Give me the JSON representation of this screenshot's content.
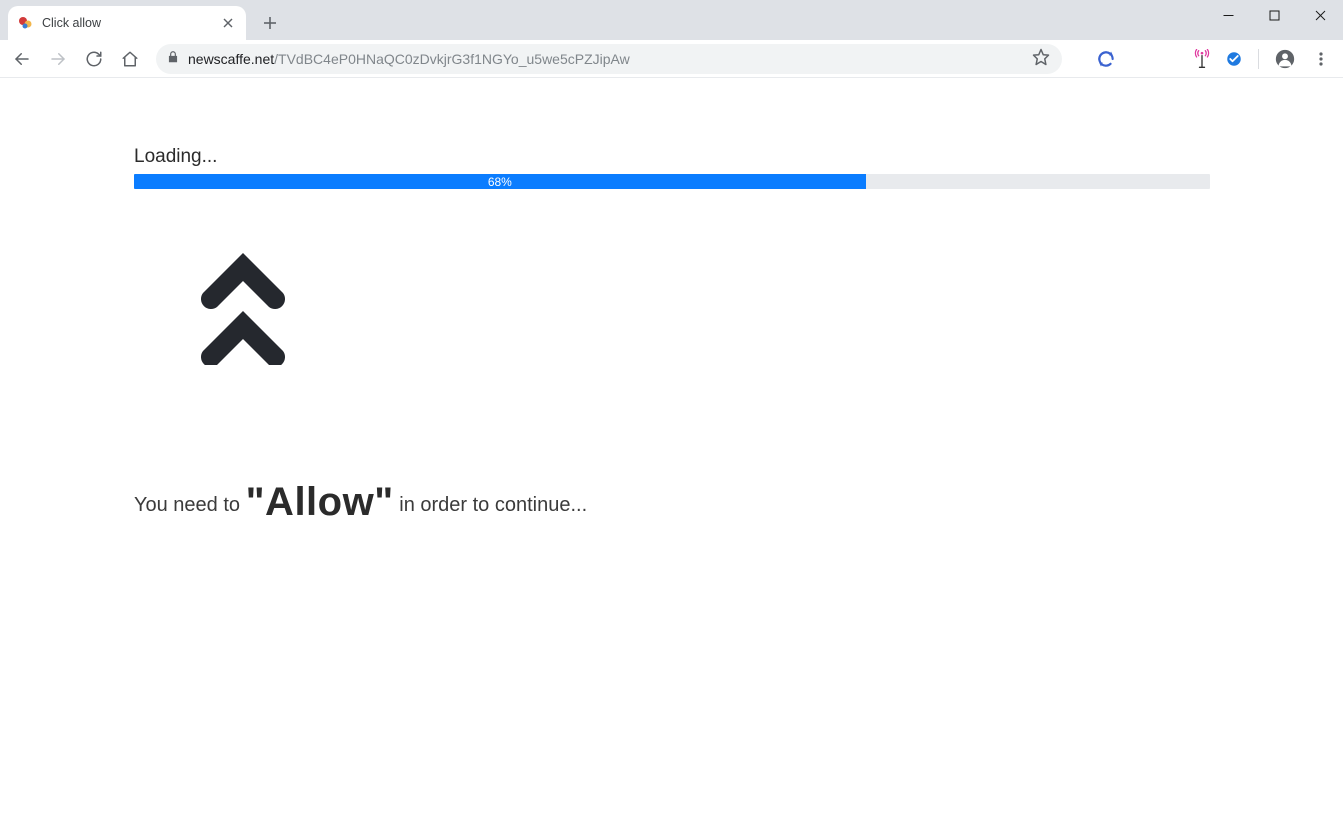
{
  "browser": {
    "tab": {
      "title": "Click allow"
    },
    "url": {
      "domain": "newscaffe.net",
      "path": "/TVdBC4eP0HNaQC0zDvkjrG3f1NGYo_u5we5cPZJipAw"
    }
  },
  "page": {
    "loading_label": "Loading...",
    "progress_percent_text": "68%",
    "progress_percent_value": 68,
    "instruction_prefix": "You need to ",
    "instruction_allow_quoted": "\"Allow\"",
    "instruction_suffix": " in order to continue..."
  },
  "colors": {
    "progress_fill": "#0b7dff",
    "progress_bg": "#e8eaed",
    "chevron": "#25282e"
  }
}
